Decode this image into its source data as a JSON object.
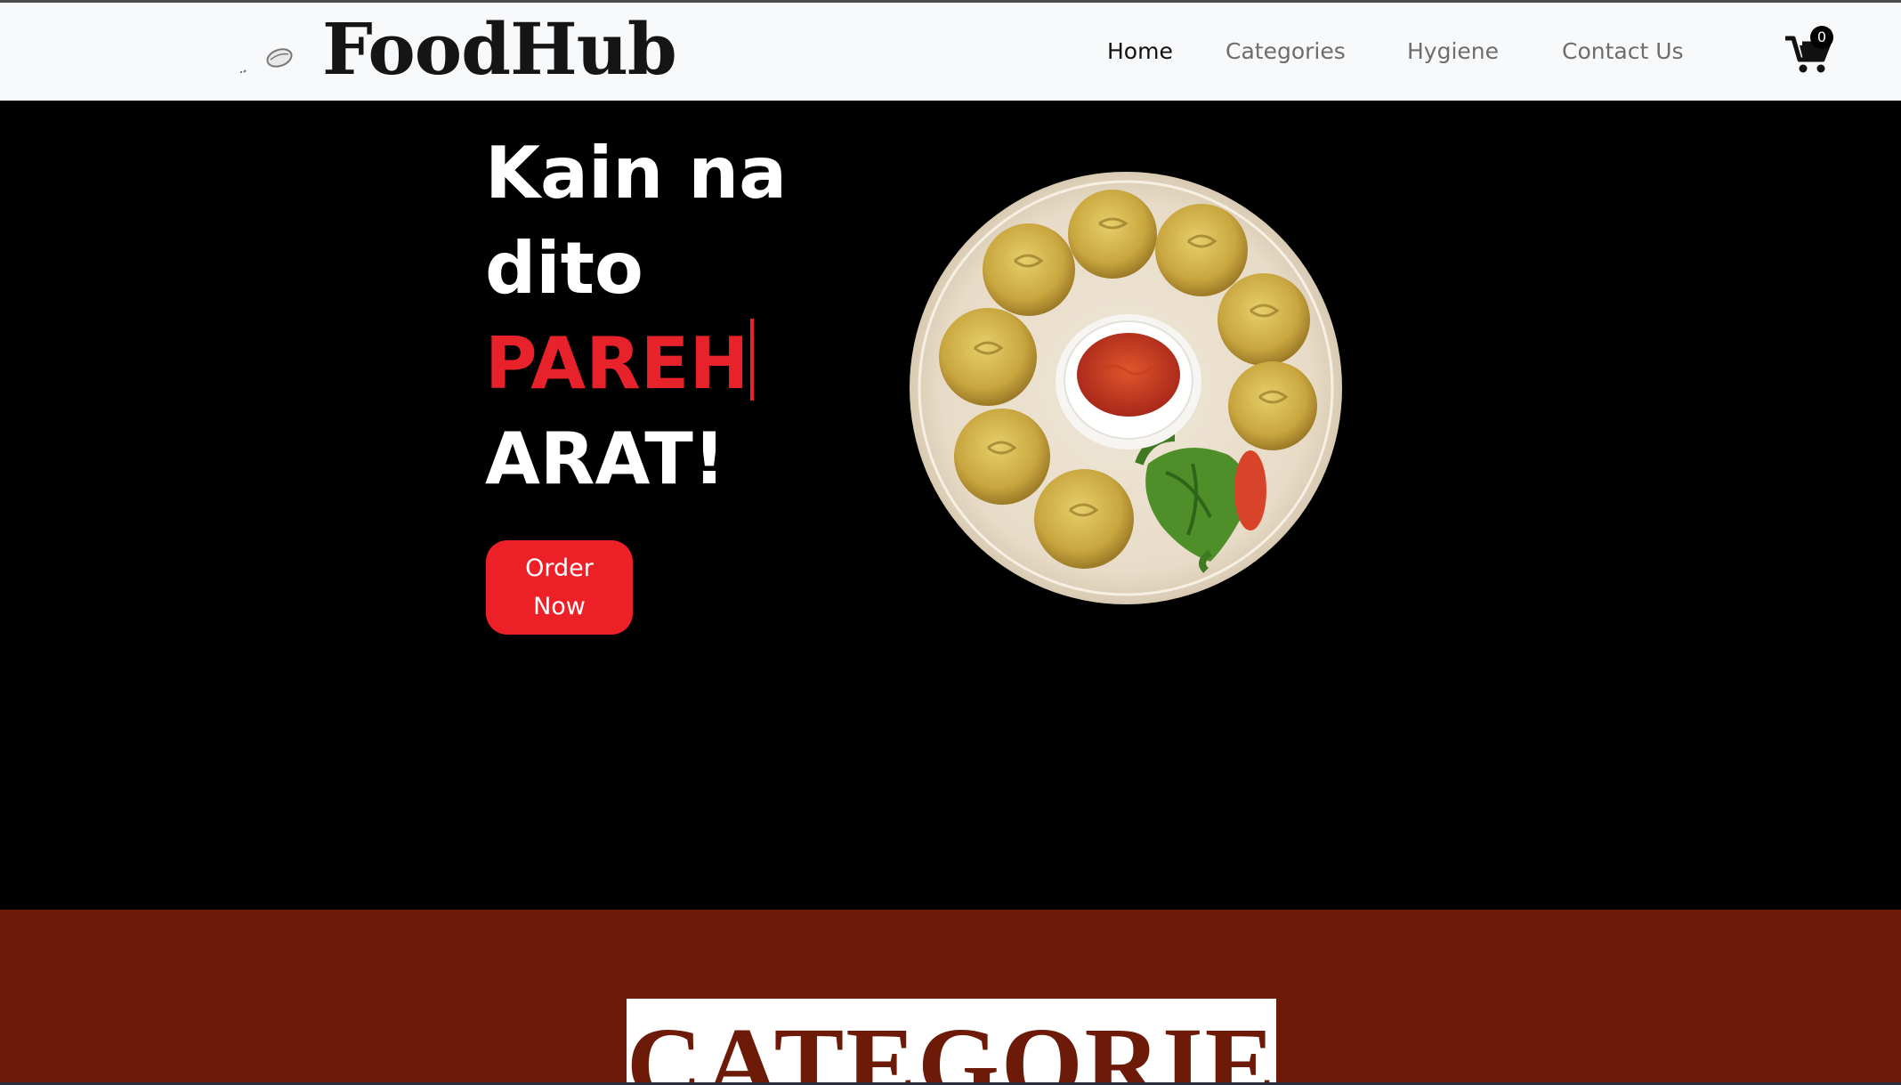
{
  "brand": {
    "name": "FoodHub",
    "logo_icon": "dumpling-icon"
  },
  "nav": {
    "items": [
      {
        "label": "Home",
        "active": true
      },
      {
        "label": "Categories",
        "active": false
      },
      {
        "label": "Hygiene",
        "active": false
      },
      {
        "label": "Contact Us",
        "active": false
      }
    ],
    "cart": {
      "icon": "cart-icon",
      "count": "0"
    }
  },
  "hero": {
    "line1": "Kain na",
    "line2": "dito",
    "accent": "PAREH",
    "line4": "ARAT!",
    "cta_label": "Order Now",
    "image": "dumpling-plate-image"
  },
  "categories": {
    "title": "CATEGORIES"
  },
  "colors": {
    "accent": "#ee2027",
    "hero_bg": "#000000",
    "navbar_bg": "#f8f9fb",
    "categories_bg": "#6e1a08"
  }
}
